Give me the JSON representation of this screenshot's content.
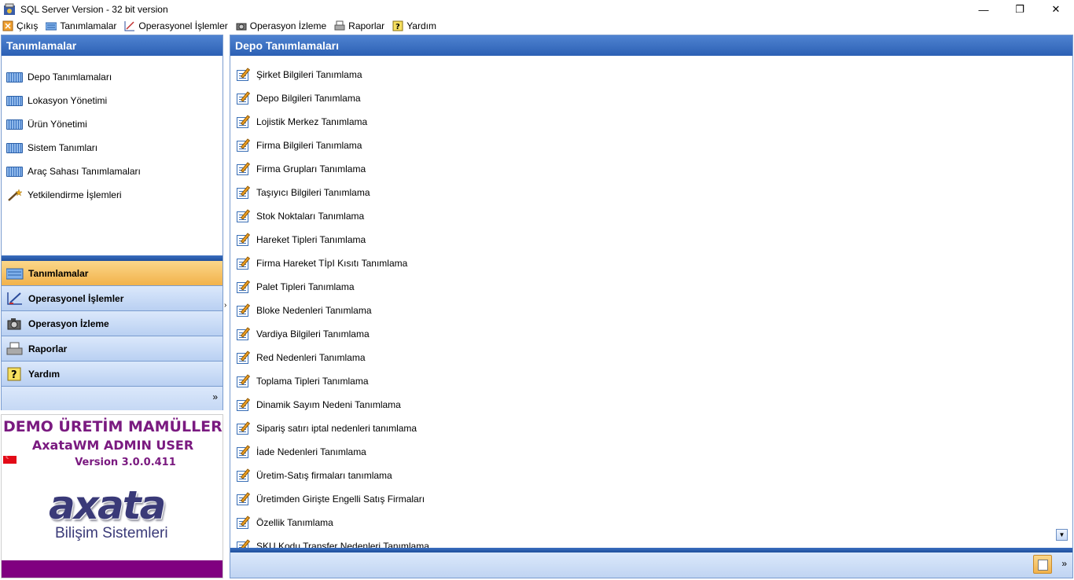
{
  "window": {
    "title": "SQL Server Version - 32 bit version",
    "minimize_glyph": "—",
    "restore_glyph": "❐",
    "close_glyph": "✕"
  },
  "menu": [
    {
      "label": "Çıkış",
      "icon": "exit-icon"
    },
    {
      "label": "Tanımlamalar",
      "icon": "keyboard-icon"
    },
    {
      "label": "Operasyonel İşlemler",
      "icon": "chart-pencil-icon"
    },
    {
      "label": "Operasyon İzleme",
      "icon": "camera-icon"
    },
    {
      "label": "Raporlar",
      "icon": "printer-icon"
    },
    {
      "label": "Yardım",
      "icon": "help-icon"
    }
  ],
  "left_panel": {
    "title": "Tanımlamalar",
    "items": [
      {
        "label": "Depo Tanımlamaları",
        "icon": "keyboard-icon"
      },
      {
        "label": "Lokasyon Yönetimi",
        "icon": "keyboard-icon"
      },
      {
        "label": "Ürün Yönetimi",
        "icon": "keyboard-icon"
      },
      {
        "label": "Sistem Tanımları",
        "icon": "keyboard-icon"
      },
      {
        "label": "Araç Sahası Tanımlamaları",
        "icon": "keyboard-icon"
      },
      {
        "label": "Yetkilendirme İşlemleri",
        "icon": "magic-wand-icon"
      }
    ],
    "groups": [
      {
        "label": "Tanımlamalar",
        "icon": "keyboard-icon",
        "active": true
      },
      {
        "label": "Operasyonel İşlemler",
        "icon": "chart-pencil-icon",
        "active": false
      },
      {
        "label": "Operasyon İzleme",
        "icon": "camera-icon",
        "active": false
      },
      {
        "label": "Raporlar",
        "icon": "printer-icon",
        "active": false
      },
      {
        "label": "Yardım",
        "icon": "help-icon",
        "active": false
      }
    ],
    "more_glyph": "»"
  },
  "info": {
    "company": "DEMO ÜRETİM MAMÜLLERİ SAN.",
    "user": "AxataWM ADMIN USER",
    "version": "Version 3.0.0.411",
    "logo_word": "axata",
    "logo_sub": "Bilişim Sistemleri"
  },
  "splitter_arrow": "›",
  "right_panel": {
    "title": "Depo Tanımlamaları",
    "items": [
      "Şirket Bilgileri Tanımlama",
      "Depo Bilgileri Tanımlama",
      "Lojistik Merkez Tanımlama",
      "Firma Bilgileri Tanımlama",
      "Firma Grupları Tanımlama",
      "Taşıyıcı Bilgileri Tanımlama",
      "Stok Noktaları Tanımlama",
      "Hareket Tipleri Tanımlama",
      "Firma Hareket TİpI Kısıtı Tanımlama",
      "Palet Tipleri Tanımlama",
      "Bloke Nedenleri Tanımlama",
      "Vardiya Bilgileri Tanımlama",
      "Red Nedenleri Tanımlama",
      "Toplama Tipleri Tanımlama",
      "Dinamik Sayım Nedeni Tanımlama",
      "Sipariş satırı iptal nedenleri tanımlama",
      "İade Nedenleri Tanımlama",
      "Üretim-Satış firmaları tanımlama",
      "Üretimden Girişte Engelli Satış Firmaları",
      "Özellik Tanımlama",
      "SKU Kodu Transfer Nedenleri Tanımlama"
    ],
    "scroll_glyph": "▼",
    "more_glyph": "»"
  },
  "colors": {
    "header_blue": "#2c60b4",
    "active_group": "#f2b24a",
    "brand_purple": "#7a1a80"
  }
}
